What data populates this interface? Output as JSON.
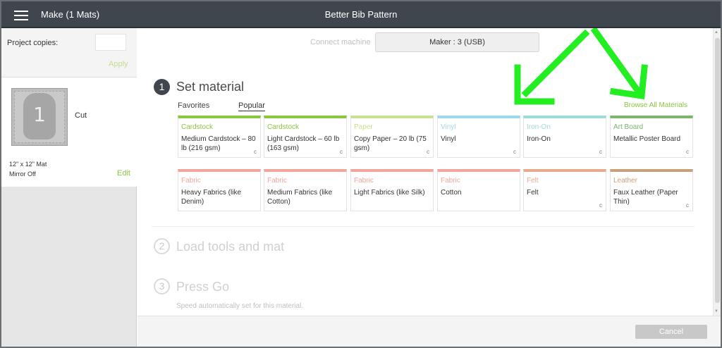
{
  "header": {
    "make_title": "Make (1 Mats)",
    "project_title": "Better Bib Pattern"
  },
  "sidebar": {
    "copies_label": "Project copies:",
    "copies_value": "",
    "apply_label": "Apply",
    "mat": {
      "number": "1",
      "operation": "Cut",
      "size": "12\" x 12\" Mat",
      "mirror": "Mirror Off",
      "edit_label": "Edit"
    }
  },
  "machine": {
    "connect_label": "Connect machine",
    "selected": "Maker : 3 (USB)"
  },
  "steps": {
    "step1": {
      "number": "1",
      "title": "Set material"
    },
    "step2": {
      "number": "2",
      "title": "Load tools and mat"
    },
    "step3": {
      "number": "3",
      "title": "Press Go",
      "subtitle": "Speed automatically set for this material."
    }
  },
  "tabs": {
    "favorites": "Favorites",
    "popular": "Popular"
  },
  "browse_label": "Browse All Materials",
  "materials": [
    {
      "category": "Cardstock",
      "name": "Medium Cardstock – 80 lb (216 gsm)",
      "color": "#8cc63f",
      "icon": "c-icon",
      "has_icon": true
    },
    {
      "category": "Cardstock",
      "name": "Light Cardstock – 60 lb (163 gsm)",
      "color": "#8cc63f",
      "icon": "c-icon",
      "has_icon": true
    },
    {
      "category": "Paper",
      "name": "Copy Paper – 20 lb (75 gsm)",
      "color": "#c9e28f",
      "icon": "c-icon",
      "has_icon": true
    },
    {
      "category": "Vinyl",
      "name": "Vinyl",
      "color": "#9fd8e8",
      "icon": "c-icon",
      "has_icon": true
    },
    {
      "category": "Iron-On",
      "name": "Iron-On",
      "color": "#9fdbd8",
      "icon": "c-icon",
      "has_icon": true
    },
    {
      "category": "Art Board",
      "name": "Metallic Poster Board",
      "color": "#7cb56b",
      "icon": "c-icon",
      "has_icon": true
    },
    {
      "category": "Fabric",
      "name": "Heavy Fabrics (like Denim)",
      "color": "#f4a59b",
      "icon": "",
      "has_icon": false
    },
    {
      "category": "Fabric",
      "name": "Medium Fabrics (like Cotton)",
      "color": "#f4a59b",
      "icon": "",
      "has_icon": false
    },
    {
      "category": "Fabric",
      "name": "Light Fabrics (like Silk)",
      "color": "#f4a59b",
      "icon": "",
      "has_icon": false
    },
    {
      "category": "Fabric",
      "name": "Cotton",
      "color": "#f4a59b",
      "icon": "",
      "has_icon": false
    },
    {
      "category": "Felt",
      "name": "Felt",
      "color": "#e8a98e",
      "icon": "c-icon",
      "has_icon": true
    },
    {
      "category": "Leather",
      "name": "Faux Leather (Paper Thin)",
      "color": "#c9a07c",
      "icon": "c-icon",
      "has_icon": true
    }
  ],
  "footer": {
    "cancel_label": "Cancel"
  },
  "colors": {
    "accent_green": "#8cc63f",
    "annotation_arrow": "#22ee22",
    "titlebar": "#3f464d"
  }
}
